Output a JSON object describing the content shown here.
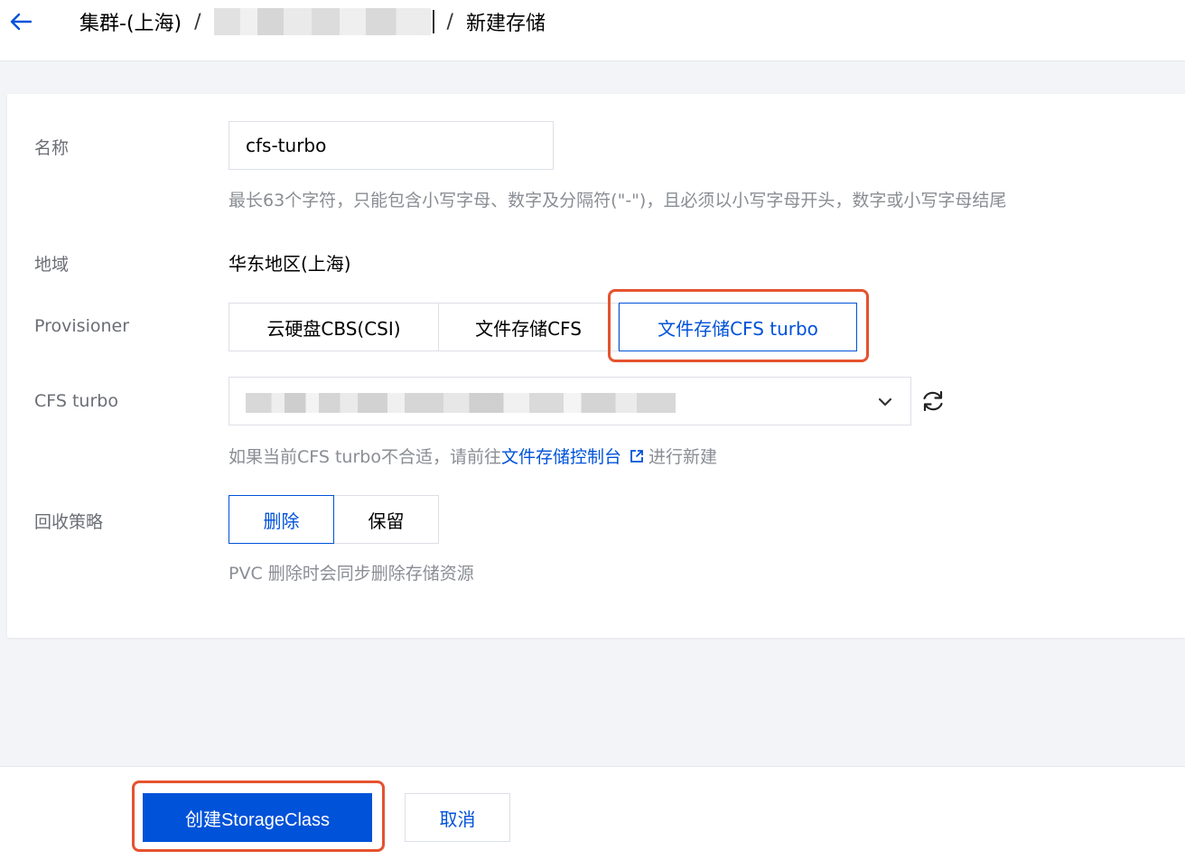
{
  "header": {
    "breadcrumb_cluster": "集群-(上海)",
    "breadcrumb_separator": "/",
    "breadcrumb_current": "新建存储"
  },
  "form": {
    "name": {
      "label": "名称",
      "value": "cfs-turbo",
      "hint": "最长63个字符，只能包含小写字母、数字及分隔符(\"-\")，且必须以小写字母开头，数字或小写字母结尾"
    },
    "region": {
      "label": "地域",
      "value": "华东地区(上海)"
    },
    "provisioner": {
      "label": "Provisioner",
      "options": [
        "云硬盘CBS(CSI)",
        "文件存储CFS",
        "文件存储CFS turbo"
      ],
      "selected": "文件存储CFS turbo"
    },
    "cfs_turbo": {
      "label": "CFS turbo",
      "hint_prefix": "如果当前CFS turbo不合适，请前往",
      "hint_link": "文件存储控制台",
      "hint_suffix": "进行新建"
    },
    "reclaim_policy": {
      "label": "回收策略",
      "options": [
        "删除",
        "保留"
      ],
      "selected": "删除",
      "hint": "PVC 删除时会同步删除存储资源"
    }
  },
  "footer": {
    "create_label": "创建StorageClass",
    "cancel_label": "取消"
  },
  "colors": {
    "primary": "#0052d9",
    "highlight": "#e5532e"
  },
  "icons": [
    "back-arrow-icon",
    "chevron-down-icon",
    "refresh-icon",
    "external-link-icon"
  ]
}
